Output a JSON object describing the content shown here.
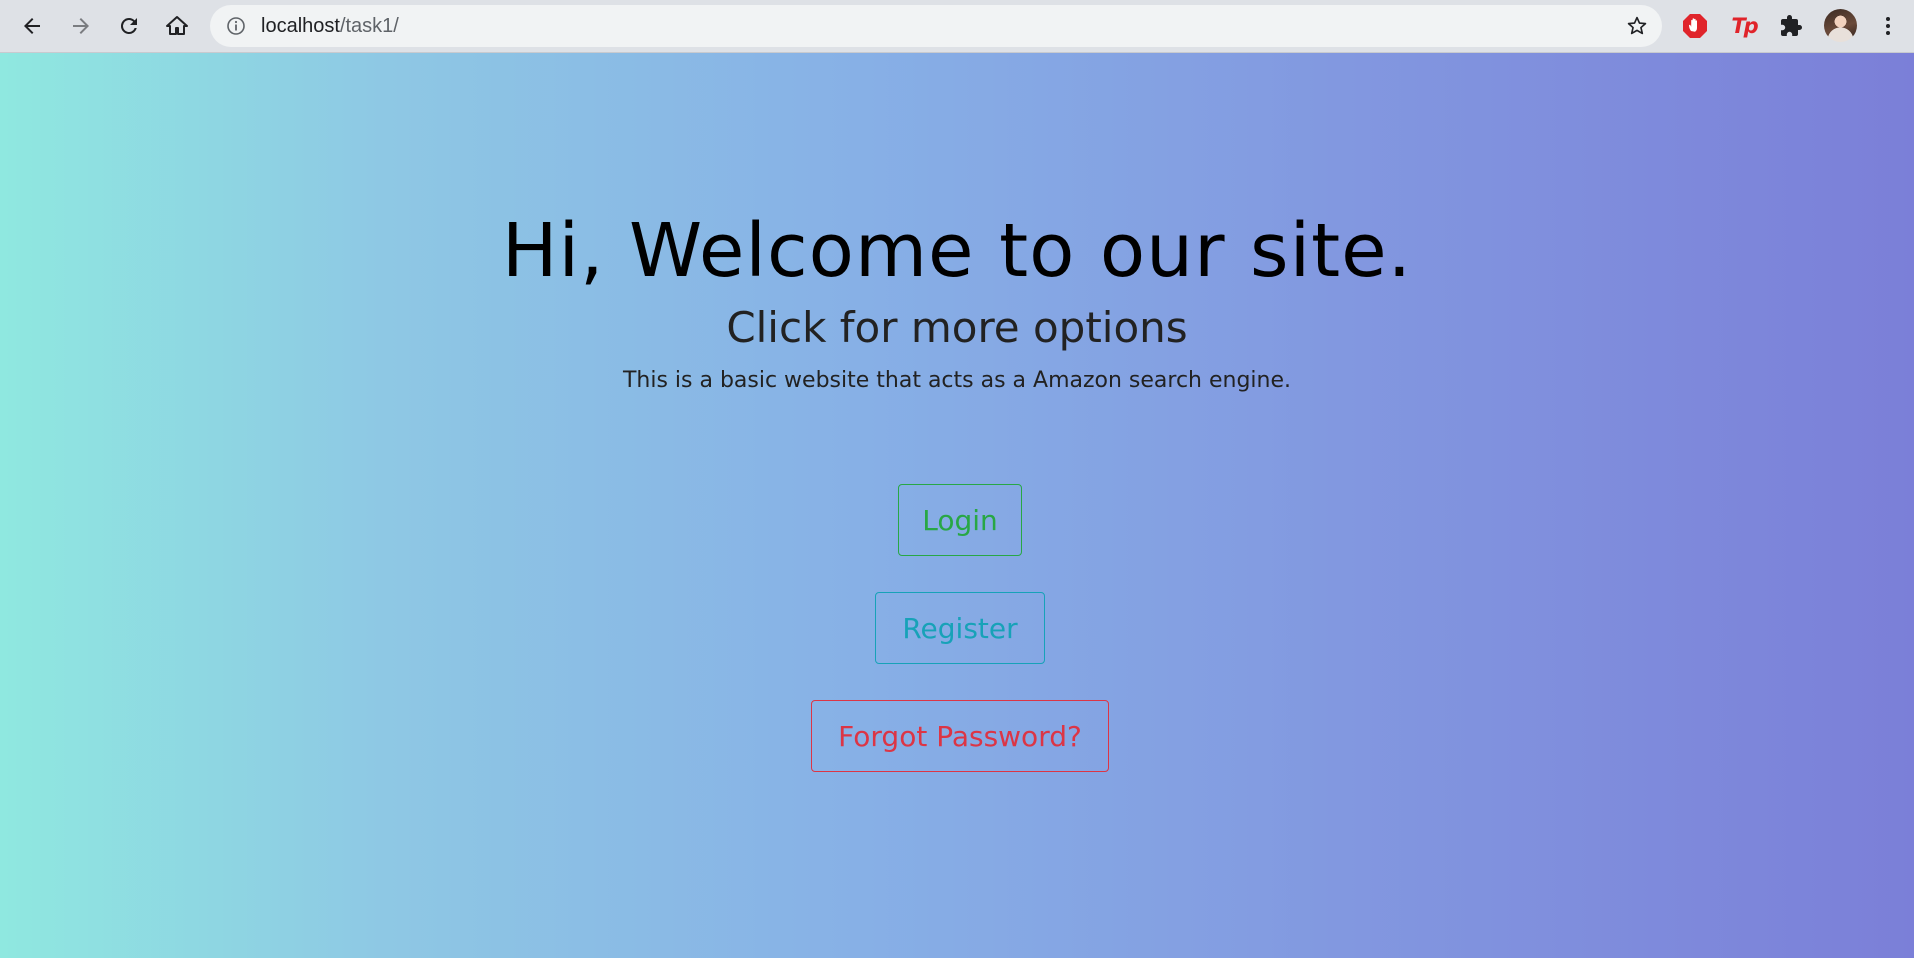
{
  "browser": {
    "url_host": "localhost",
    "url_path": "/task1/",
    "icons": {
      "back": "arrow-left-icon",
      "forward": "arrow-right-icon",
      "reload": "reload-icon",
      "home": "home-icon",
      "site_info": "info-icon",
      "bookmark": "star-icon",
      "extension_1": "adblock-hand-icon",
      "extension_2": "tp-icon",
      "extensions": "puzzle-icon",
      "profile": "avatar",
      "menu": "kebab-menu-icon"
    },
    "extension_2_text": "Tp"
  },
  "page": {
    "headline": "Hi, Welcome to our site.",
    "subhead": "Click for more options",
    "description": "This is a basic website that acts as a Amazon search engine.",
    "buttons": {
      "login": "Login",
      "register": "Register",
      "forgot": "Forgot Password?"
    }
  },
  "colors": {
    "gradient_start": "#8fe8e0",
    "gradient_end": "#7b7fd8",
    "login": "#28a745",
    "register": "#17a2b8",
    "forgot": "#dc3545"
  }
}
